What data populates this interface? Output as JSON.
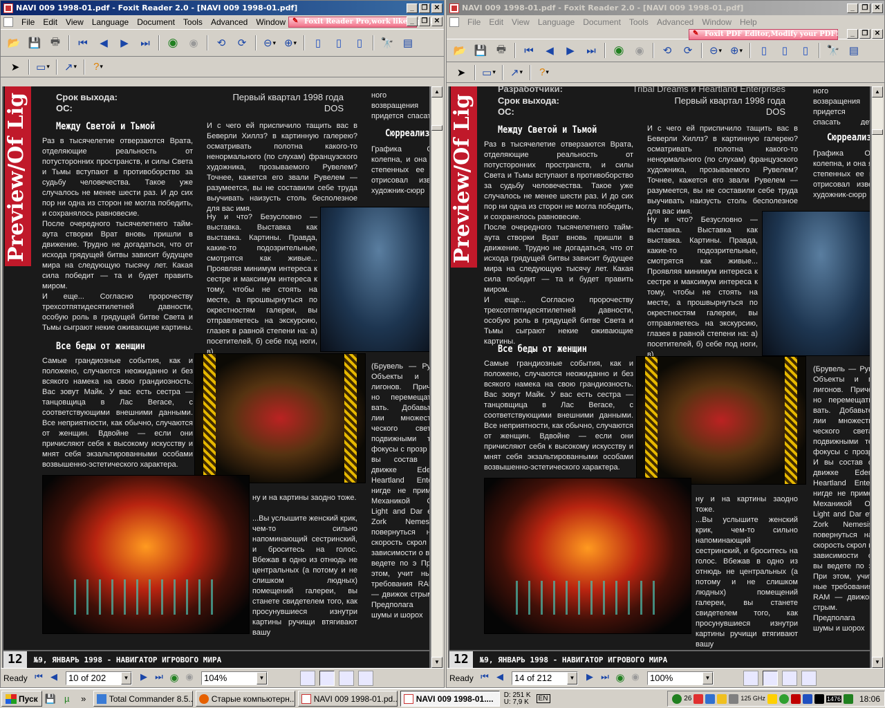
{
  "left_window": {
    "title": "NAVI 009 1998-01.pdf - Foxit Reader 2.0 - [NAVI 009 1998-01.pdf]",
    "promo": "Foxit Reader Pro,work like a pro!",
    "status": {
      "ready": "Ready",
      "page": "10 of 202",
      "zoom": "104%"
    }
  },
  "right_window": {
    "title": "NAVI 009 1998-01.pdf - Foxit Reader 2.0 - [NAVI 009 1998-01.pdf]",
    "promo": "Foxit PDF Editor,Modify your PDF!",
    "status": {
      "ready": "Ready",
      "page": "14 of 212",
      "zoom": "100%"
    }
  },
  "menu": [
    "File",
    "Edit",
    "View",
    "Language",
    "Document",
    "Tools",
    "Advanced",
    "Window",
    "Help"
  ],
  "caption_buttons": {
    "minimize": "_",
    "restore": "❐",
    "close": "✕"
  },
  "article": {
    "side_title": "Preview/Of Lig",
    "dev_label": "Разработчики:",
    "dev_value": "Tribal Dreams и Heartland Enterprises",
    "release_label": "Срок выхода:",
    "release_value": "Первый квартал 1998 года",
    "os_label": "ОС:",
    "os_value": "DOS",
    "heading1": "Между Светой и Тьмой",
    "heading2": "Все беды от женщин",
    "heading3": "Сюрреализм",
    "col1_p1": "Раз в тысячелетие отверзаются Врата, отделяющие реальность от потусторонних пространств, и силы Света и Тьмы вступают в противоборство за судьбу человечества. Такое уже случалось не менее шести раз. И до сих пор ни одна из сторон не могла победить, и сохранялось равновесие.",
    "col1_p2": "После очередного тысячелетнего тайм-аута створки Врат вновь пришли в движение. Трудно не догадаться, что от исхода грядущей битвы зависит будущее мира на следующую тысячу лет. Какая сила победит — та и будет править миром.",
    "col1_p3": "И еще... Согласно пророчеству трехсотпятидесятилетней давности, особую роль в грядущей битве Света и Тьмы сыграют некие оживающие картины.",
    "col1_p4": "Самые грандиозные события, как и положено, случаются неожиданно и без всякого намека на свою грандиозность. Вас зовут Майк. У вас есть сестра — танцовщица в Лас Вегасе, с соответствующими внешними данными. Все неприятности, как обычно, случаются от женщин. Вдвойне — если они причисляют себя к высокому искусству и мнят себя экзальтированными особами возвышенно-эстетического характера.",
    "col2_p1": "И с чего ей приспичило тащить вас в Беверли Хиллз? в картинную галерею? осматривать полотна какого-то ненормального (по слухам) французского художника, прозываемого Рувелем? Точнее, кажется его звали Рувелем — разумеется, вы не составили себе труда выучивать наизусть столь бесполезное для вас имя.",
    "col2_p2": "Ну и что? Безусловно — выставка. Выставка как выставка. Картины. Правда, какие-то подозрительные, смотрятся как живые... Проявляя минимум интереса к сестре и максимум интереса к тому, чтобы не стоять на месте, а прошвырнуться по окрестностям галереи, вы отправляетесь на экскурсию, глазея в равной степени на: а) посетителей, б) себе под ноги, в)",
    "col2_p3": "ну и на картины заодно тоже.",
    "col2_p4": "...Вы услышите женский крик, чем-то сильно напоминающий сестринский, и броситесь на голос. Вбежав в одно из отнюдь не центральных (а потому и не слишком людных) помещений галереи, вы станете свидетелем того, как просунувшиеся изнутри картины ручищи втягивают вашу",
    "col3_p1": "ного возвращения придется спасать дет некуда.",
    "col3_p2": "Графика Of колепна, и она я степенных ее к отрисовал изве художник-сюрр",
    "col3_p3": "(Брувель — Рув Объекты и п лигонов. Приче но перемещать вать. Добавьте лии множеств ческого света подвижными те фокусы с прозр И вы состав о движке Eden Heartland Enter нигде не приме Механикой Of Light and Dar ет Zork Nemesis повернуться на скорость скрол в зависимости о вы ведете по э При этом, учит ные требования RAM — движок стрым. Предполага шумы и шорох",
    "footer_page": "12",
    "footer_text": "№9, ЯНВАРЬ 1998 - НАВИГАТОР ИГРОВОГО МИРА"
  },
  "taskbar": {
    "start": "Пуск",
    "tasks": [
      "Total Commander 8.5...",
      "Старые компьютерн...",
      "NAVI 009 1998-01.pd...",
      "NAVI 009 1998-01...."
    ],
    "net_down": "D: 251 K",
    "net_up": "U: 7,9 K",
    "lang": "EN",
    "tray_num": "26",
    "cpu": "125 GHz",
    "mem": "1476",
    "clock": "18:06"
  }
}
